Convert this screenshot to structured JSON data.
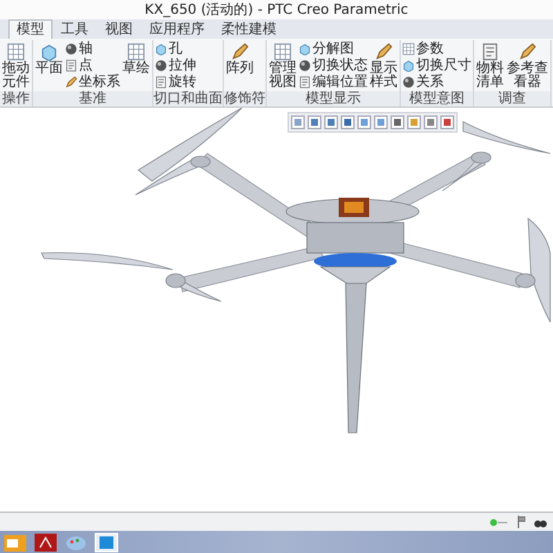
{
  "window": {
    "title": "KX_650 (活动的) - PTC Creo Parametric"
  },
  "tabs": [
    {
      "label": "模型",
      "selected": true
    },
    {
      "label": "工具",
      "selected": false
    },
    {
      "label": "视图",
      "selected": false
    },
    {
      "label": "应用程序",
      "selected": false
    },
    {
      "label": "柔性建模",
      "selected": false
    }
  ],
  "ribbon_groups": [
    {
      "label": "操作",
      "items": [
        {
          "kind": "large",
          "label": "拖动元件"
        }
      ]
    },
    {
      "label": "基准",
      "items": [
        {
          "kind": "large",
          "label": "平面"
        },
        {
          "kind": "stack",
          "labels": [
            "轴",
            "点",
            "坐标系"
          ]
        },
        {
          "kind": "large",
          "label": "草绘"
        }
      ]
    },
    {
      "label": "切口和曲面",
      "items": [
        {
          "kind": "stack",
          "labels": [
            "孔",
            "拉伸",
            "旋转"
          ]
        }
      ]
    },
    {
      "label": "修饰符",
      "items": [
        {
          "kind": "large",
          "label": "阵列"
        }
      ]
    },
    {
      "label": "模型显示",
      "items": [
        {
          "kind": "large",
          "label": "管理视图"
        },
        {
          "kind": "stack",
          "labels": [
            "分解图",
            "切换状态",
            "编辑位置"
          ]
        },
        {
          "kind": "large",
          "label": "显示样式"
        }
      ]
    },
    {
      "label": "模型意图",
      "items": [
        {
          "kind": "stack",
          "labels": [
            "参数",
            "切换尺寸",
            "关系"
          ]
        }
      ]
    },
    {
      "label": "调查",
      "items": [
        {
          "kind": "large",
          "label": "物料清单"
        },
        {
          "kind": "large",
          "label": "参考查看器"
        }
      ]
    }
  ]
}
